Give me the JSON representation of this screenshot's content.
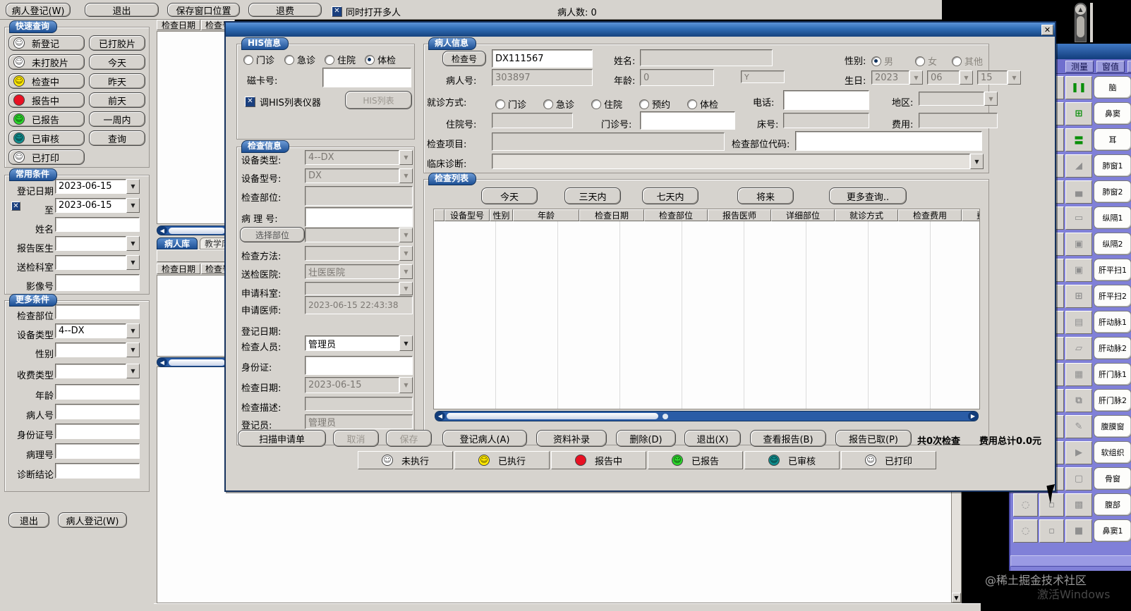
{
  "top_bar": {
    "patient_reg_label": "病人登记(W)",
    "exit_label": "退出",
    "save_window_pos_label": "保存窗口位置",
    "refund_label": "退费",
    "multi_open_label": "同时打开多人",
    "patient_count_label": "病人数: 0"
  },
  "quick_query": {
    "title": "快速查询",
    "status_buttons": [
      {
        "label": "新登记",
        "color": "#ffffff"
      },
      {
        "label": "未打胶片",
        "color": "#ffffff"
      },
      {
        "label": "检查中",
        "color": "#ffe800"
      },
      {
        "label": "报告中",
        "color": "#e81123"
      },
      {
        "label": "已报告",
        "color": "#2bd42b"
      },
      {
        "label": "已审核",
        "color": "#0f8b8b"
      },
      {
        "label": "已打印",
        "color": "#ffffff"
      }
    ],
    "range_buttons": [
      "已打胶片",
      "今天",
      "昨天",
      "前天",
      "一周内",
      "查询"
    ]
  },
  "common_filters": {
    "title": "常用条件",
    "reg_date_label": "登记日期",
    "reg_date_value": "2023-06-15",
    "to_label": "至",
    "to_value": "2023-06-15",
    "name_label": "姓名",
    "report_doctor_label": "报告医生",
    "dept_label": "送检科室",
    "image_no_label": "影像号"
  },
  "more_filters": {
    "title": "更多条件",
    "body_part_label": "检查部位",
    "device_type_label": "设备类型",
    "device_type_value": "4--DX",
    "gender_label": "性别",
    "fee_type_label": "收费类型",
    "age_label": "年龄",
    "patient_no_label": "病人号",
    "id_no_label": "身份证号",
    "path_no_label": "病理号",
    "diagnosis_label": "诊断结论"
  },
  "sidebar_bottom": {
    "exit_label": "退出",
    "patient_reg_label": "病人登记(W)"
  },
  "bg_list": {
    "col_date": "检查日期",
    "col_no": "检查号",
    "tab_patient_lib": "病人库",
    "tab_teaching_lib": "教学库"
  },
  "dialog": {
    "his": {
      "title": "HIS信息",
      "radios": [
        "门诊",
        "急诊",
        "住院",
        "体检"
      ],
      "selected": "体检",
      "mag_card_label": "磁卡号:",
      "his_device_checkbox": "调HIS列表仪器",
      "his_list_button": "HIS列表"
    },
    "exam_info": {
      "title": "检查信息",
      "device_type_label": "设备类型:",
      "device_type_value": "4--DX",
      "device_model_label": "设备型号:",
      "device_model_value": "DX",
      "body_part_label": "检查部位:",
      "path_no_label": "病 理 号:",
      "select_part_button": "选择部位",
      "method_label": "检查方法:",
      "hospital_label": "送检医院:",
      "hospital_value": "壮医医院",
      "req_dept_label": "申请科室:",
      "req_doctor_label": "申请医师:",
      "req_doctor_value": "2023-06-15 22:43:38",
      "reg_date_label": "登记日期:",
      "examiner_label": "检查人员:",
      "examiner_value": "管理员",
      "id_label": "身份证:",
      "exam_date_label": "检查日期:",
      "exam_date_value": "2023-06-15",
      "exam_desc_label": "检查描述:",
      "registrar_label": "登记员:",
      "registrar_value": "管理员"
    },
    "patient_info": {
      "title": "病人信息",
      "exam_no_button": "检查号",
      "exam_no_value": "DX111567",
      "patient_no_label": "病人号:",
      "patient_no_value": "303897",
      "name_label": "姓名:",
      "age_label": "年龄:",
      "age_value": "0",
      "age_unit": "Y",
      "gender_label": "性别:",
      "gender_options": [
        "男",
        "女",
        "其他"
      ],
      "gender_selected": "男",
      "birth_label": "生日:",
      "birth_year": "2023",
      "birth_month": "06",
      "birth_day": "15",
      "visit_label": "就诊方式:",
      "visit_options": [
        "门诊",
        "急诊",
        "住院",
        "预约",
        "体检"
      ],
      "phone_label": "电话:",
      "area_label": "地区:",
      "inpatient_label": "住院号:",
      "outpatient_label": "门诊号:",
      "bed_label": "床号:",
      "fee_label": "费用:",
      "exam_item_label": "检查项目:",
      "part_code_label": "检查部位代码:",
      "clinical_dx_label": "临床诊断:"
    },
    "exam_list": {
      "title": "检查列表",
      "filter_buttons": [
        "今天",
        "三天内",
        "七天内",
        "将来",
        "更多查询.."
      ],
      "columns": [
        "设备型号",
        "性别",
        "年龄",
        "检查日期",
        "检查部位",
        "报告医师",
        "详细部位",
        "就诊方式",
        "检查费用",
        "费用类别"
      ]
    },
    "actions": {
      "scan_request": "扫描申请单",
      "cancel": "取消",
      "save": "保存",
      "register_patient": "登记病人(A)",
      "supplement": "资料补录",
      "delete": "删除(D)",
      "exit": "退出(X)",
      "view_report": "查看报告(B)",
      "report_taken": "报告已取(P)",
      "count_text": "共0次检查",
      "fee_text": "费用总计0.0元"
    },
    "status_legend": [
      {
        "label": "未执行",
        "color": "#ffffff"
      },
      {
        "label": "已执行",
        "color": "#ffe800"
      },
      {
        "label": "报告中",
        "color": "#e81123"
      },
      {
        "label": "已报告",
        "color": "#2bd42b"
      },
      {
        "label": "已审核",
        "color": "#0f8b8b"
      },
      {
        "label": "已打印",
        "color": "#ffffff"
      }
    ]
  },
  "right_panel": {
    "tabs": [
      "测量",
      "窗值"
    ],
    "preset_buttons": [
      "脑",
      "鼻窦",
      "耳",
      "肺窗1",
      "肺窗2",
      "纵隔1",
      "纵隔2",
      "肝平扫1",
      "肝平扫2",
      "肝动脉1",
      "肝动脉2",
      "肝门脉1",
      "肝门脉2",
      "腹膜窗",
      "软组织",
      "骨窗",
      "腹部",
      "鼻窦1"
    ],
    "icon_glyphs": [
      "❚❚",
      "⊞",
      "〓",
      "◢",
      "▄",
      "▭",
      "▣",
      "▣",
      "⊞",
      "▤",
      "▱",
      "▦",
      "⧉",
      "✎",
      "▶",
      "▢",
      "▩",
      "■"
    ]
  },
  "watermark": {
    "line1": "@稀土掘金技术社区",
    "line2": "激活Windows"
  }
}
